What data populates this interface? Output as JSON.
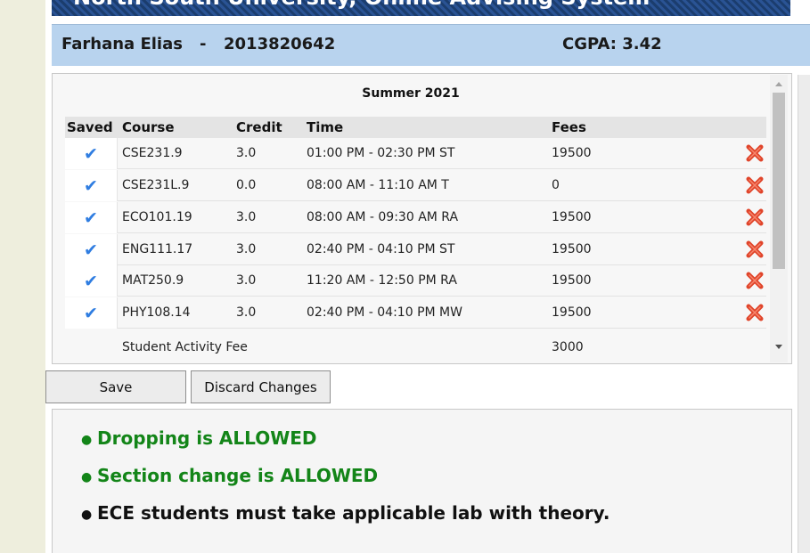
{
  "header": {
    "system_title": "North South University, Online Advising System"
  },
  "student": {
    "name": "Farhana Elias",
    "separator": "-",
    "id": "2013820642",
    "cgpa_label": "CGPA: 3.42"
  },
  "schedule": {
    "semester": "Summer 2021",
    "columns": {
      "saved": "Saved",
      "course": "Course",
      "credit": "Credit",
      "time": "Time",
      "fees": "Fees"
    },
    "rows": [
      {
        "saved_icon": "check-icon",
        "course": "CSE231.9",
        "credit": "3.0",
        "time": "01:00 PM - 02:30 PM ST",
        "fees": "19500"
      },
      {
        "saved_icon": "check-icon",
        "course": "CSE231L.9",
        "credit": "0.0",
        "time": "08:00 AM - 11:10 AM T",
        "fees": "0"
      },
      {
        "saved_icon": "check-icon",
        "course": "ECO101.19",
        "credit": "3.0",
        "time": "08:00 AM - 09:30 AM RA",
        "fees": "19500"
      },
      {
        "saved_icon": "check-icon",
        "course": "ENG111.17",
        "credit": "3.0",
        "time": "02:40 PM - 04:10 PM ST",
        "fees": "19500"
      },
      {
        "saved_icon": "check-icon",
        "course": "MAT250.9",
        "credit": "3.0",
        "time": "11:20 AM - 12:50 PM RA",
        "fees": "19500"
      },
      {
        "saved_icon": "check-icon",
        "course": "PHY108.14",
        "credit": "3.0",
        "time": "02:40 PM - 04:10 PM MW",
        "fees": "19500"
      }
    ],
    "activity_fee": {
      "label": "Student Activity Fee",
      "amount": "3000"
    }
  },
  "buttons": {
    "save": "Save",
    "discard": "Discard Changes"
  },
  "notices": [
    {
      "text": "Dropping is ALLOWED",
      "color": "#138518"
    },
    {
      "text": "Section change is ALLOWED",
      "color": "#138518"
    },
    {
      "text": "ECE students must take applicable lab with theory.",
      "color": "#111111"
    }
  ],
  "colors": {
    "banner": "#1b3d6e",
    "student_bar": "#b8d3ee",
    "check": "#2f7de1",
    "delete": "#e0442a",
    "allowed": "#138518"
  },
  "icons": {
    "saved": "check-icon",
    "remove": "delete-x-icon"
  }
}
